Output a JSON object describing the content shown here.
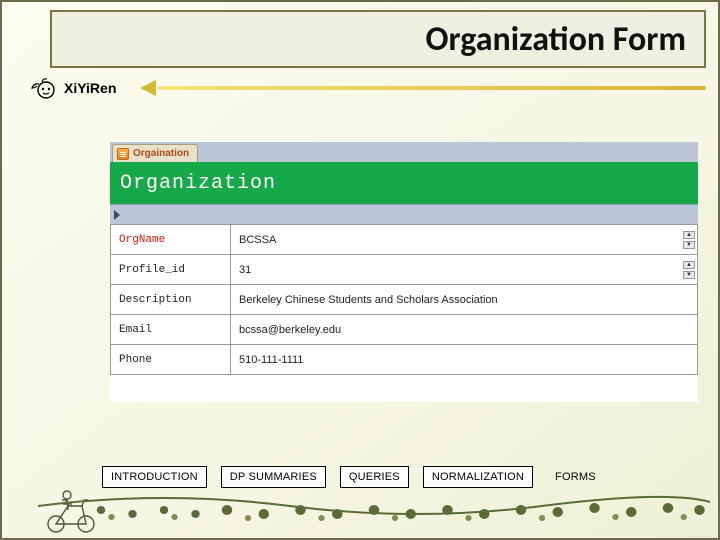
{
  "title": "Organization Form",
  "logo_text": "XiYiRen",
  "form": {
    "tab_label": "Orgaination",
    "header": "Organization",
    "fields": [
      {
        "label": "OrgName",
        "value": "BCSSA",
        "required": true,
        "spin": true
      },
      {
        "label": "Profile_id",
        "value": "31",
        "required": false,
        "spin": true
      },
      {
        "label": "Description",
        "value": "Berkeley Chinese Students and Scholars Association",
        "required": false,
        "spin": false
      },
      {
        "label": "Email",
        "value": "bcssa@berkeley.edu",
        "required": false,
        "spin": false
      },
      {
        "label": "Phone",
        "value": "510-111-1111",
        "required": false,
        "spin": false
      }
    ]
  },
  "nav": {
    "introduction": "INTRODUCTION",
    "dp_summaries": "DP SUMMARIES",
    "queries": "QUERIES",
    "normalization": "NORMALIZATION",
    "forms": "FORMS"
  }
}
